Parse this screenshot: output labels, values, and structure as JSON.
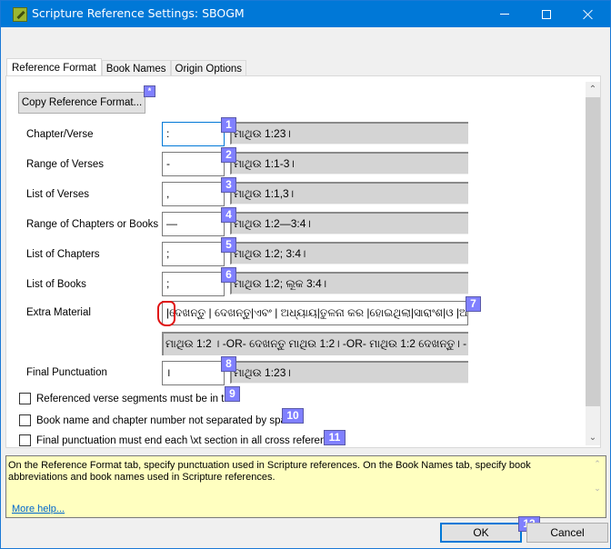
{
  "window": {
    "title": "Scripture Reference Settings: SBOGM",
    "app_icon": "paratext-icon",
    "controls": {
      "minimize": "minimize-icon",
      "maximize": "maximize-icon",
      "close": "close-icon"
    }
  },
  "tabs": [
    {
      "label": "Reference Format",
      "active": true
    },
    {
      "label": "Book Names",
      "active": false
    },
    {
      "label": "Origin Options",
      "active": false
    }
  ],
  "copy_button": {
    "label": "Copy Reference Format...",
    "badge": "*"
  },
  "rows": [
    {
      "label": "Chapter/Verse",
      "value": ":",
      "preview": "ମାଥିଉ 1:23।",
      "badge": "1"
    },
    {
      "label": "Range of Verses",
      "value": "-",
      "preview": "ମାଥିଉ 1:1-3।",
      "badge": "2"
    },
    {
      "label": "List of Verses",
      "value": ",",
      "preview": "ମାଥିଉ 1:1,3।",
      "badge": "3"
    },
    {
      "label": "Range of Chapters or Books",
      "value": "—",
      "preview": "ମାଥିଉ 1:2—3:4।",
      "badge": "4"
    },
    {
      "label": "List of Chapters",
      "value": ";",
      "preview": "ମାଥିଉ 1:2; 3:4।",
      "badge": "5"
    },
    {
      "label": "List of Books",
      "value": ";",
      "preview": "ମାଥିଉ 1:2; ଲୂକ 3:4।",
      "badge": "6"
    }
  ],
  "extra_material": {
    "label": "Extra Material",
    "value": "|ଦେଖନ୍ତୁ | ଦେଖନ୍ତୁ|ଏବଂ | ଅଧ୍ୟାୟ|ତୁଳନା କର |ହୋଇଥିଲା|ସାରାଂଶ|ଓ |ଆରୁ",
    "preview": "ମାଥିଉ 1:2 ।  -OR-  ଦେଖନ୍ତୁ ମାଥିଉ 1:2।  -OR-  ମାଥିଉ 1:2 ଦେଖନ୍ତୁ।  -",
    "badge": "7"
  },
  "final_punctuation": {
    "label": "Final Punctuation",
    "value": "।",
    "preview": "ମାଥିଉ 1:23।",
    "badge": "8"
  },
  "checkboxes": [
    {
      "label": "Referenced verse segments must be in text",
      "checked": false,
      "badge": "9"
    },
    {
      "label": "Book name and chapter number not separated by space",
      "checked": false,
      "badge": "10"
    },
    {
      "label": "Final punctuation must end each \\xt section in all cross references",
      "checked": false,
      "badge": "11"
    }
  ],
  "help": {
    "text": "On the Reference Format tab, specify punctuation used in Scripture references. On the Book Names tab, specify book abbreviations and book names used in Scripture references.",
    "link": "More help..."
  },
  "buttons": {
    "ok": "OK",
    "cancel": "Cancel",
    "badge": "12"
  },
  "colors": {
    "titlebar": "#0078d7",
    "badge": "#8080ff",
    "help_bg": "#ffffc0",
    "annotation": "#e01010"
  }
}
